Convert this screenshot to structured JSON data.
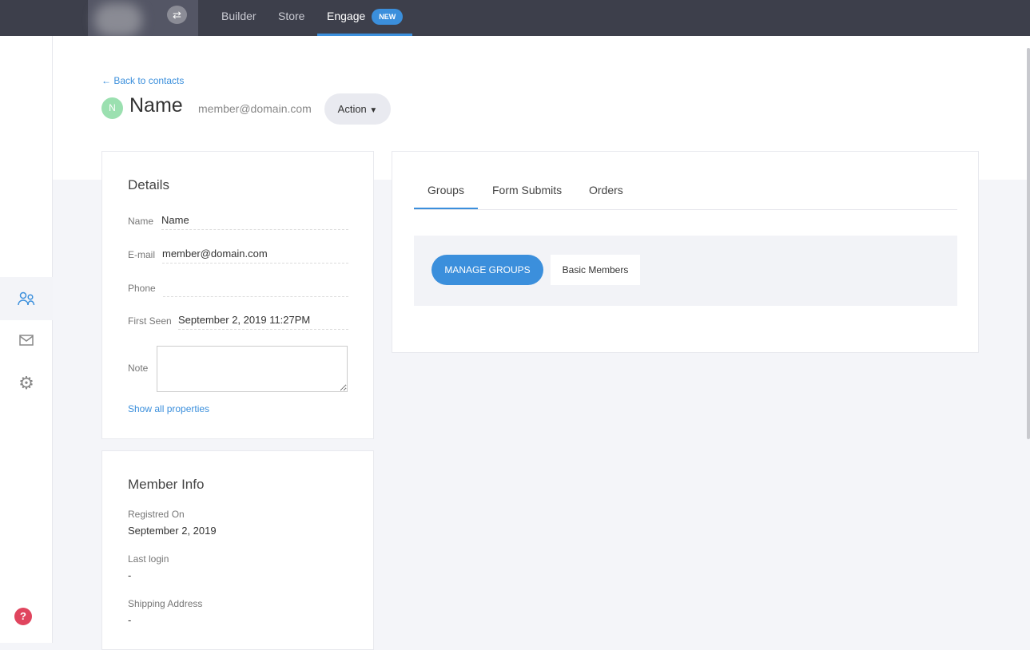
{
  "topbar": {
    "nav": [
      "Builder",
      "Store",
      "Engage"
    ],
    "new_badge": "NEW"
  },
  "header": {
    "back": "← Back to contacts",
    "avatar_letter": "N",
    "name": "Name",
    "email": "member@domain.com",
    "action": "Action"
  },
  "details": {
    "title": "Details",
    "fields": [
      {
        "label": "Name",
        "value": "Name"
      },
      {
        "label": "E-mail",
        "value": "member@domain.com"
      },
      {
        "label": "Phone",
        "value": ""
      },
      {
        "label": "First Seen",
        "value": "September 2, 2019 11:27PM"
      }
    ],
    "note_label": "Note",
    "note_value": "",
    "show_all": "Show all properties"
  },
  "member_info": {
    "title": "Member Info",
    "registered_label": "Registred On",
    "registered": "September 2, 2019",
    "last_login_label": "Last login",
    "last_login": "-",
    "shipping_label": "Shipping Address",
    "shipping": "-"
  },
  "tabs": [
    "Groups",
    "Form Submits",
    "Orders"
  ],
  "groups": {
    "manage": "MANAGE GROUPS",
    "items": [
      "Basic Members"
    ]
  }
}
